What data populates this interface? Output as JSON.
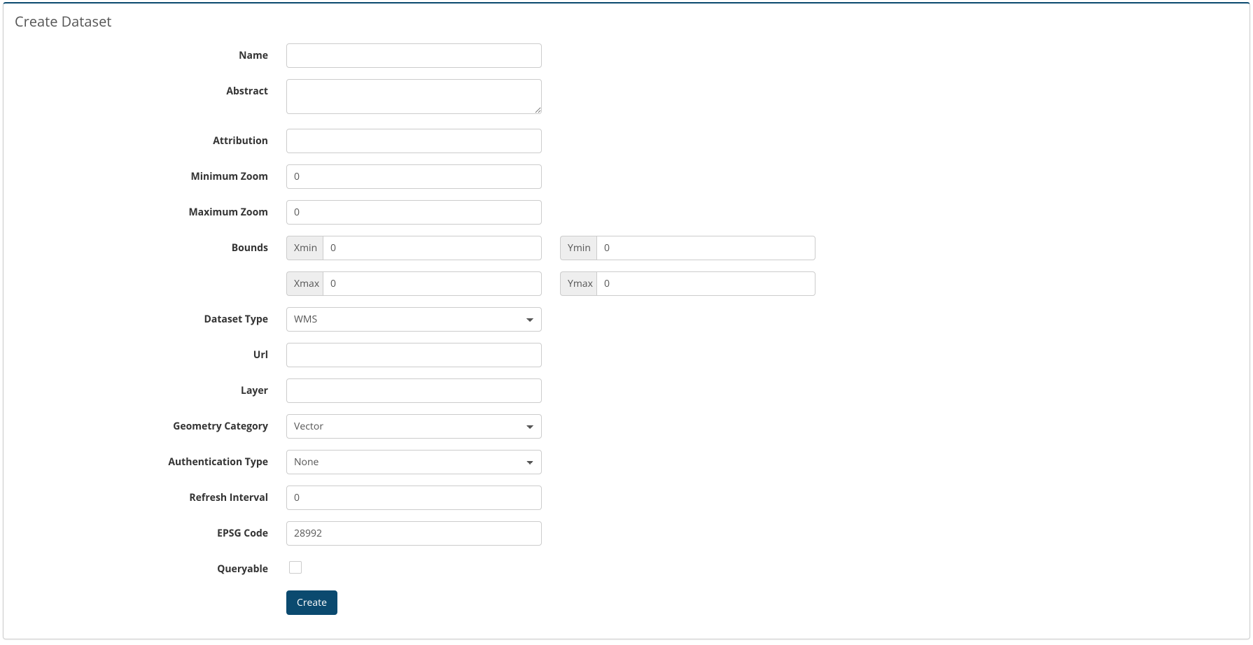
{
  "panel": {
    "title": "Create Dataset"
  },
  "labels": {
    "name": "Name",
    "abstract": "Abstract",
    "attribution": "Attribution",
    "min_zoom": "Minimum Zoom",
    "max_zoom": "Maximum Zoom",
    "bounds": "Bounds",
    "dataset_type": "Dataset Type",
    "url": "Url",
    "layer": "Layer",
    "geometry_category": "Geometry Category",
    "auth_type": "Authentication Type",
    "refresh_interval": "Refresh Interval",
    "epsg_code": "EPSG Code",
    "queryable": "Queryable"
  },
  "bounds_addons": {
    "xmin": "Xmin",
    "ymin": "Ymin",
    "xmax": "Xmax",
    "ymax": "Ymax"
  },
  "values": {
    "name": "",
    "abstract": "",
    "attribution": "",
    "min_zoom": "0",
    "max_zoom": "0",
    "xmin": "0",
    "ymin": "0",
    "xmax": "0",
    "ymax": "0",
    "dataset_type": "WMS",
    "url": "",
    "layer": "",
    "geometry_category": "Vector",
    "auth_type": "None",
    "refresh_interval": "0",
    "epsg_code": "28992",
    "queryable": false
  },
  "buttons": {
    "create": "Create"
  }
}
